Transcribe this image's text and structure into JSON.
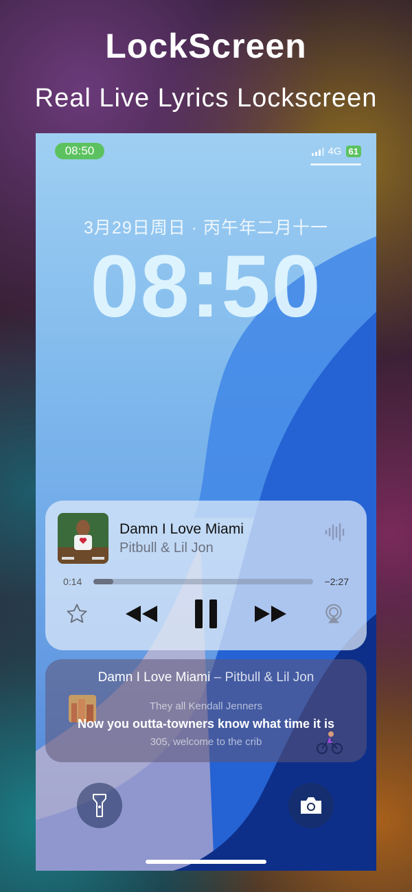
{
  "promo": {
    "title": "LockScreen",
    "subtitle": "Real Live Lyrics Lockscreen"
  },
  "status_bar": {
    "time": "08:50",
    "network": "4G",
    "battery": "61"
  },
  "lockscreen": {
    "date": "3月29日周日 · 丙午年二月十一",
    "clock": "08:50"
  },
  "now_playing": {
    "title": "Damn I Love Miami",
    "artist": "Pitbull & Lil Jon",
    "elapsed": "0:14",
    "remaining": "−2:27",
    "progress_fraction": 0.09
  },
  "lyrics": {
    "title": "Damn I Love Miami",
    "separator": "–",
    "artist": "Pitbull & Lil Jon",
    "previous_line": "They all Kendall Jenners",
    "current_line": "Now you outta-towners know what time it is",
    "next_line": "305, welcome to the crib"
  },
  "icons": {
    "favorite": "star-icon",
    "rewind": "rewind-icon",
    "pause": "pause-icon",
    "forward": "fast-forward-icon",
    "airplay": "airplay-icon",
    "flashlight": "flashlight-icon",
    "camera": "camera-icon",
    "waveform": "waveform-icon"
  },
  "colors": {
    "status_green": "#5cc25f",
    "wallpaper_blue": "#6da6e8",
    "deep_blue": "#1f5fd6"
  }
}
